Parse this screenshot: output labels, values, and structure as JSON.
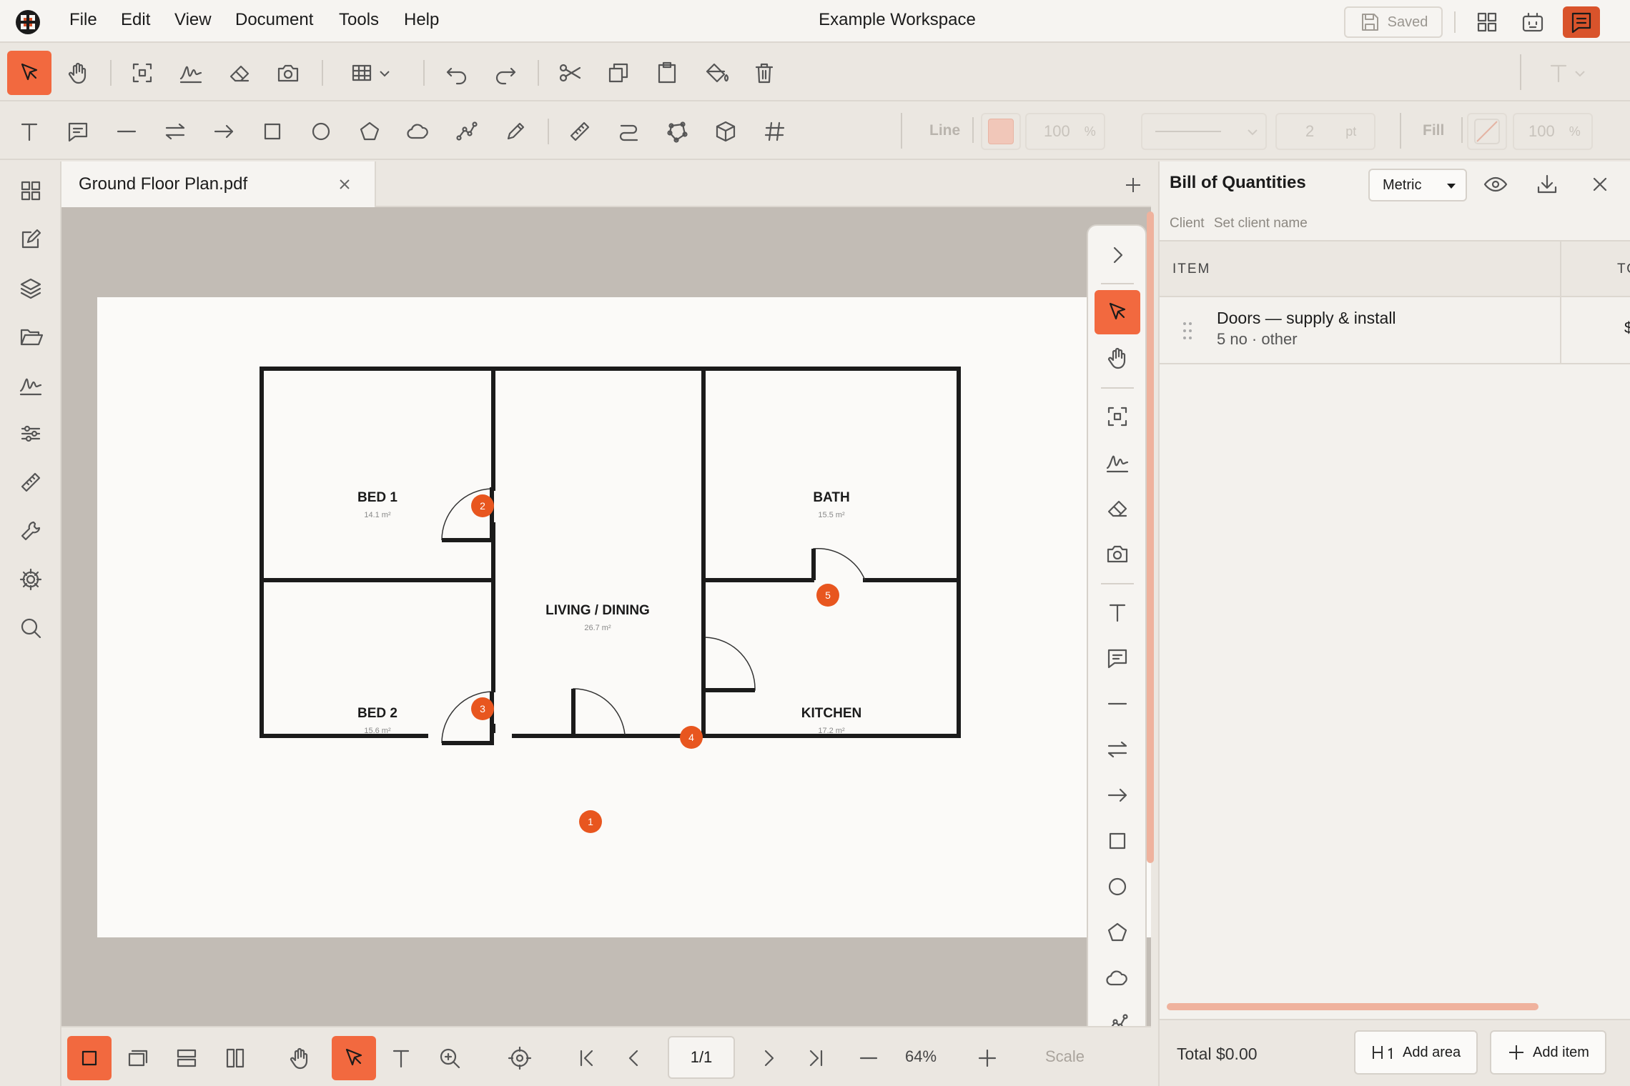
{
  "menubar": {
    "items": [
      "File",
      "Edit",
      "View",
      "Document",
      "Tools",
      "Help"
    ],
    "title": "Example Workspace",
    "saved_label": "Saved"
  },
  "colors": {
    "accent": "#f2693f",
    "accent_dark": "#d9532b",
    "door_marker": "#e8561f",
    "scrollbar": "#efb29d"
  },
  "toolbar2": {
    "line_label": "Line",
    "line_opacity": "100",
    "line_opacity_unit": "%",
    "line_width": "2",
    "line_width_unit": "pt",
    "fill_label": "Fill",
    "fill_opacity": "100",
    "fill_opacity_unit": "%"
  },
  "document": {
    "tab_title": "Ground Floor Plan.pdf"
  },
  "floorplan": {
    "rooms": [
      {
        "name": "BED 1",
        "area": "14.1 m²"
      },
      {
        "name": "BATH",
        "area": "15.5 m²"
      },
      {
        "name": "LIVING / DINING",
        "area": "26.7 m²"
      },
      {
        "name": "BED 2",
        "area": "15.6 m²"
      },
      {
        "name": "KITCHEN",
        "area": "17.2 m²"
      }
    ],
    "doors": [
      "1",
      "2",
      "3",
      "4",
      "5"
    ]
  },
  "bottombar": {
    "page": "1/1",
    "zoom": "64%",
    "scale_label": "Scale"
  },
  "bill": {
    "title": "Bill of Quantities",
    "unit": "Metric",
    "unit_options": [
      "Metric"
    ],
    "client_label": "Client",
    "client_placeholder": "Set client name",
    "col_item": "ITEM",
    "col_total": "TO",
    "rows": [
      {
        "title": "Doors — supply & install",
        "sub": "5 no · other",
        "value": "$"
      }
    ],
    "total": "Total $0.00",
    "add_area": "Add area",
    "add_item": "Add item"
  }
}
